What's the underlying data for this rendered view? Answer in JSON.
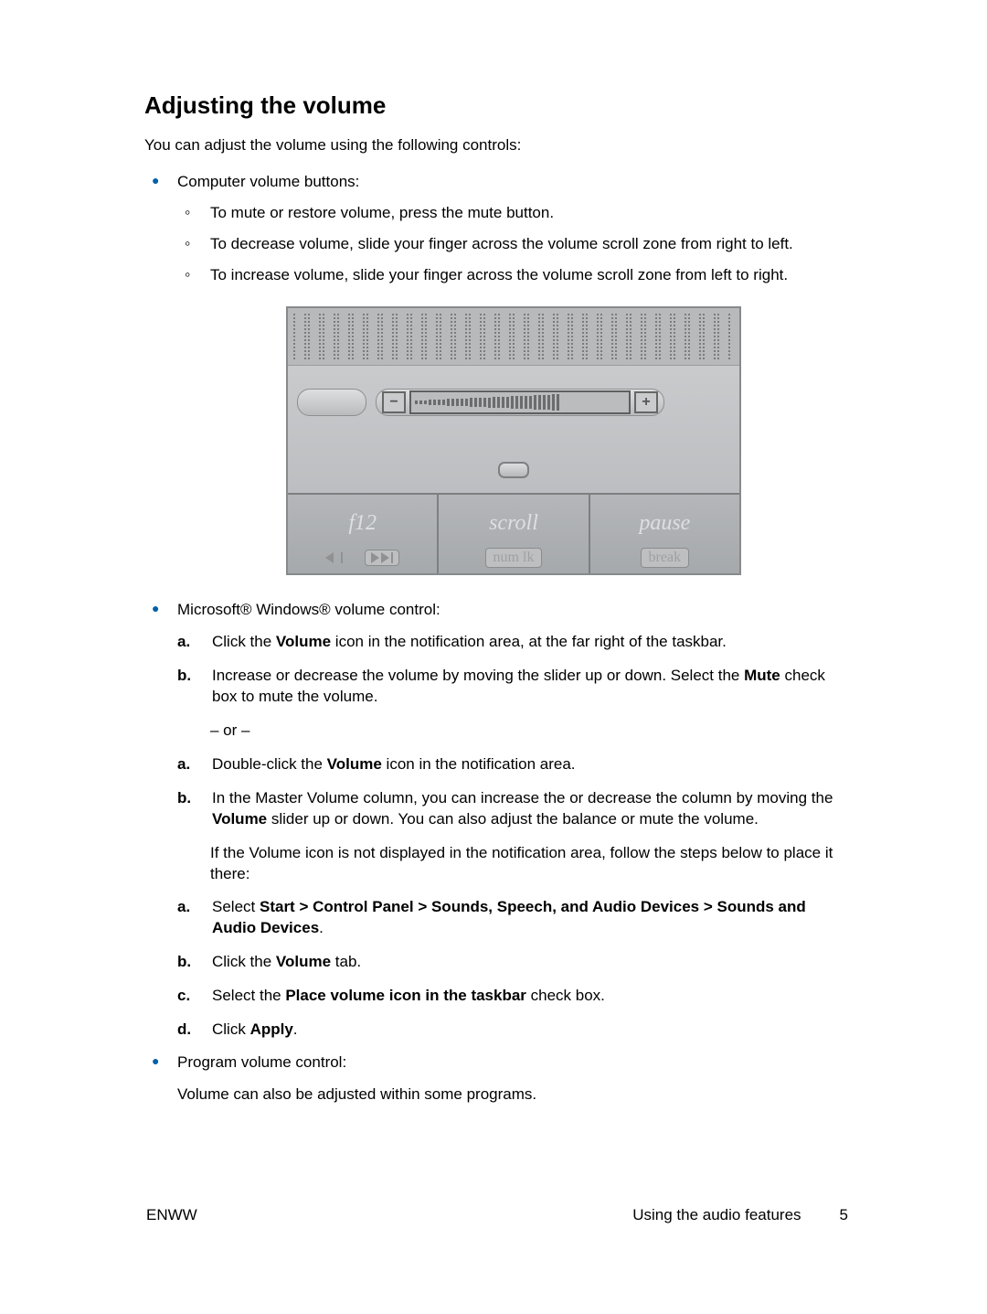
{
  "title": "Adjusting the volume",
  "intro": "You can adjust the volume using the following controls:",
  "b1": {
    "heading": "Computer volume buttons:",
    "s1": "To mute or restore volume, press the mute button.",
    "s2": "To decrease volume, slide your finger across the volume scroll zone from right to left.",
    "s3": "To increase volume, slide your finger across the volume scroll zone from left to right."
  },
  "illus": {
    "k1_big": "f12",
    "k2_big": "scroll",
    "k2_small": "num lk",
    "k3_big": "pause",
    "k3_small": "break"
  },
  "b2": {
    "heading": "Microsoft® Windows® volume control:",
    "l1a_pre": "Click the ",
    "l1a_bold": "Volume",
    "l1a_post": " icon in the notification area, at the far right of the taskbar.",
    "l1b_pre": "Increase or decrease the volume by moving the slider up or down. Select the ",
    "l1b_bold": "Mute",
    "l1b_post": " check box to mute the volume.",
    "or": "– or –",
    "l2a_pre": "Double-click the ",
    "l2a_bold": "Volume",
    "l2a_post": " icon in the notification area.",
    "l2b_pre": "In the Master Volume column, you can increase the or decrease the column by moving the ",
    "l2b_bold": "Volume",
    "l2b_post": " slider up or down. You can also adjust the balance or mute the volume.",
    "note": "If the Volume icon is not displayed in the notification area, follow the steps below to place it there:",
    "p1_pre": "Select ",
    "p1_bold": "Start > Control Panel > Sounds, Speech, and Audio Devices > Sounds and Audio Devices",
    "p1_post": ".",
    "p2_pre": "Click the ",
    "p2_bold": "Volume",
    "p2_post": " tab.",
    "p3_pre": "Select the ",
    "p3_bold": "Place volume icon in the taskbar",
    "p3_post": " check box.",
    "p4_pre": "Click ",
    "p4_bold": "Apply",
    "p4_post": "."
  },
  "b3": {
    "heading": "Program volume control:",
    "body": "Volume can also be adjusted within some programs."
  },
  "footer": {
    "left": "ENWW",
    "section": "Using the audio features",
    "page": "5"
  },
  "letters": {
    "a": "a.",
    "b": "b.",
    "c": "c.",
    "d": "d."
  }
}
